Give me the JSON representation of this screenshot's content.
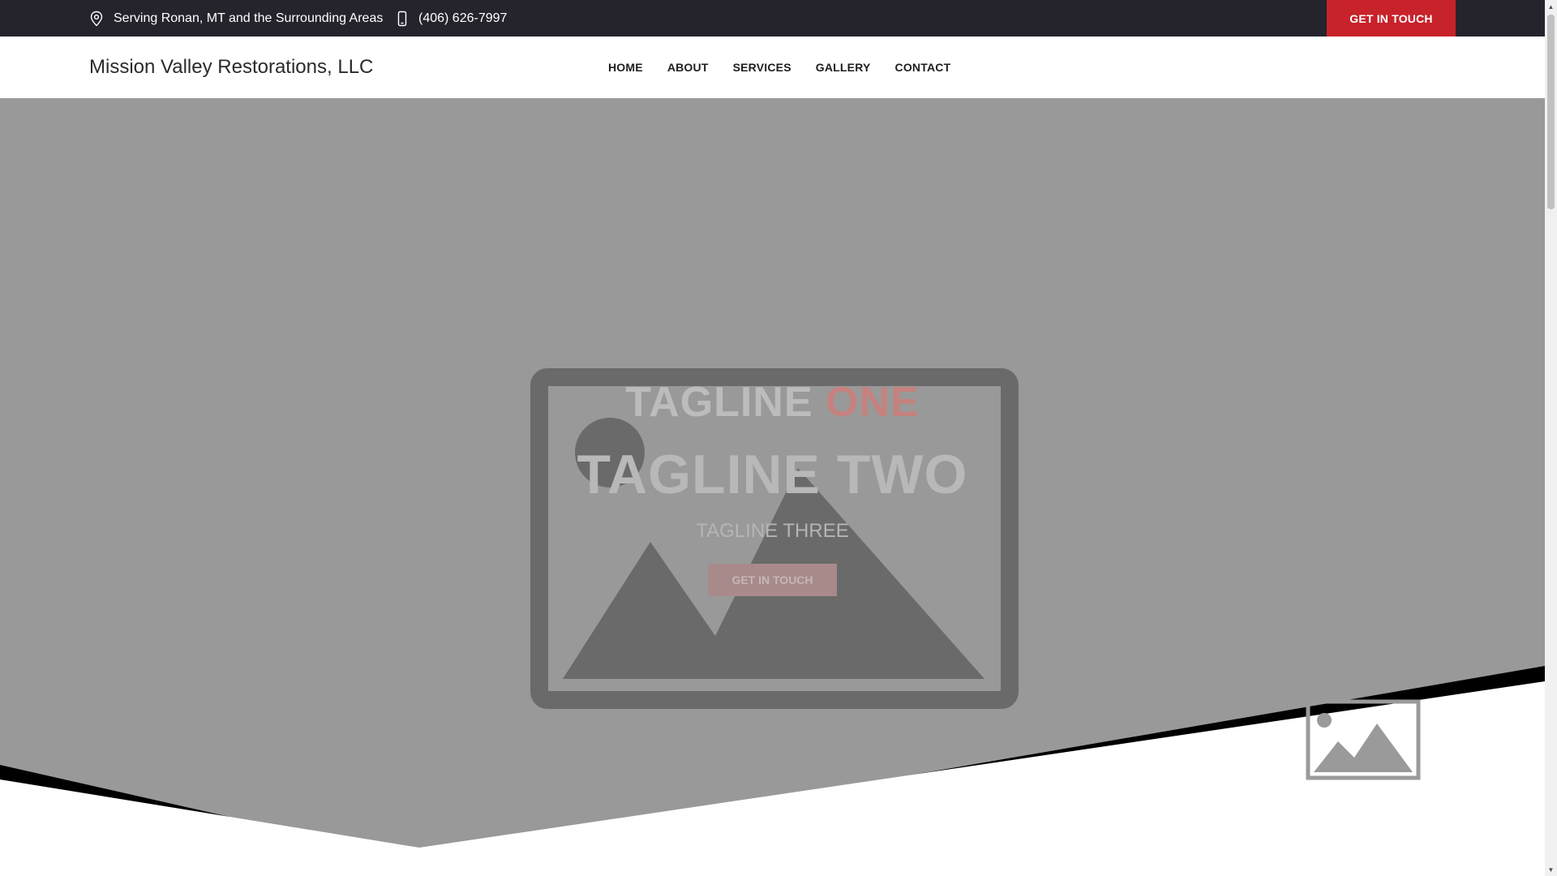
{
  "topbar": {
    "location_text": "Serving Ronan, MT and the Surrounding Areas",
    "location_icon": "map-pin-icon",
    "phone_text": "(406) 626-7997",
    "phone_icon": "mobile-phone-icon",
    "cta_label": "GET IN TOUCH"
  },
  "header": {
    "logo_text": "Mission Valley Restorations, LLC",
    "nav": [
      {
        "label": "HOME"
      },
      {
        "label": "ABOUT"
      },
      {
        "label": "SERVICES"
      },
      {
        "label": "GALLERY"
      },
      {
        "label": "CONTACT"
      }
    ]
  },
  "hero": {
    "tagline_one_a": "TAGLINE ",
    "tagline_one_b": "ONE",
    "tagline_two": "TAGLINE TWO",
    "tagline_three": "TAGLINE THREE",
    "cta_label": "GET IN TOUCH",
    "background_icon": "image-placeholder-icon"
  },
  "colors": {
    "topbar_bg": "#25242d",
    "accent": "#c8222b",
    "hero_bg": "#999999"
  }
}
